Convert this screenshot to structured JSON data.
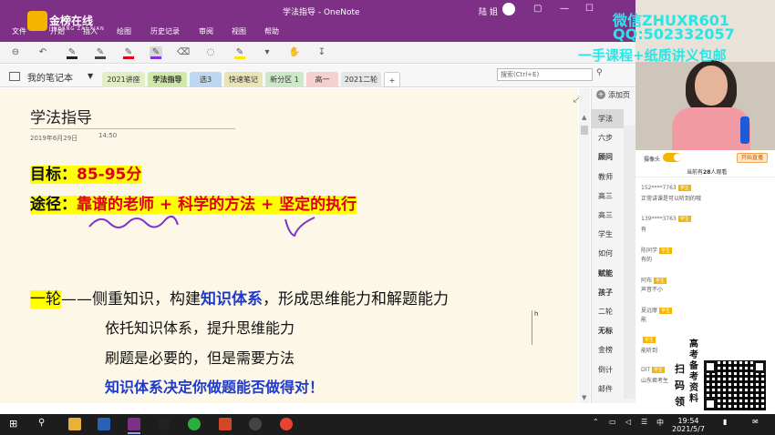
{
  "window": {
    "title": "学法指导 - OneNote",
    "user": "陆 姐",
    "brand": "金榜在线",
    "brand_sub": "JINBANG ZAI XIAN"
  },
  "ribbon_tabs": [
    "文件",
    "开始",
    "插入",
    "绘图",
    "历史记录",
    "审阅",
    "视图",
    "帮助"
  ],
  "notebook": {
    "name": "我的笔记本",
    "sections": [
      {
        "label": "2021讲座",
        "color": "#e3edc6"
      },
      {
        "label": "学法指导",
        "color": "#d8edb9"
      },
      {
        "label": "选3",
        "color": "#bfd8ef"
      },
      {
        "label": "快速笔记",
        "color": "#e9e4b6"
      },
      {
        "label": "新分区 1",
        "color": "#cde8c6"
      },
      {
        "label": "高一",
        "color": "#f4d0d0"
      },
      {
        "label": "2021二轮",
        "color": "#e6e6e6"
      }
    ],
    "add_tab": "+",
    "search_placeholder": "搜索(Ctrl+E)"
  },
  "page": {
    "title": "学法指导",
    "date": "2019年6月29日",
    "time": "14:50",
    "goal_label": "目标：",
    "goal_value": "85-95分",
    "path_label": "途径：",
    "path_value": "靠谱的老师 + 科学的方法 + 坚定的执行",
    "round_label": "一轮",
    "round_dash": "——侧重知识，构建",
    "round_blue": "知识体系",
    "round_rest": "，形成思维能力和解题能力",
    "line2": "依托知识体系，提升思维能力",
    "line3": "刷题是必要的，但是需要方法",
    "line4": "知识体系决定你做题能否做得对！",
    "cursor_mark": "h"
  },
  "page_list": {
    "add_label": "添加页",
    "items": [
      {
        "label": "学法",
        "selected": true,
        "bold": false
      },
      {
        "label": "六步",
        "selected": false,
        "bold": false
      },
      {
        "label": "顾问",
        "selected": false,
        "bold": true
      },
      {
        "label": "教师",
        "selected": false,
        "bold": false
      },
      {
        "label": "高三",
        "selected": false,
        "bold": false
      },
      {
        "label": "高三",
        "selected": false,
        "bold": false
      },
      {
        "label": "学生",
        "selected": false,
        "bold": false
      },
      {
        "label": "如何",
        "selected": false,
        "bold": false
      },
      {
        "label": "赋能",
        "selected": false,
        "bold": true
      },
      {
        "label": "孩子",
        "selected": false,
        "bold": true
      },
      {
        "label": "二轮",
        "selected": false,
        "bold": false
      },
      {
        "label": "无标",
        "selected": false,
        "bold": true
      },
      {
        "label": "金榜",
        "selected": false,
        "bold": false
      },
      {
        "label": "倒计",
        "selected": false,
        "bold": false
      },
      {
        "label": "邮件",
        "selected": false,
        "bold": false
      }
    ]
  },
  "watermark": {
    "line1": "微信ZHUXR601",
    "line2": "QQ:502332057",
    "line3": "一手课程+纸质讲义包邮"
  },
  "live": {
    "cam_label": "摄像头",
    "viewers_prefix": "当前有",
    "viewers_count": "28",
    "viewers_suffix": "人观看",
    "open_button": "开始直播",
    "messages": [
      {
        "name": "152****7763",
        "tag": "学生",
        "text": "正常讲课是可以听到的哦"
      },
      {
        "name": "139****3763",
        "tag": "学生",
        "text": "有"
      },
      {
        "name": "陈同学",
        "tag": "学生",
        "text": "有的"
      },
      {
        "name": "阿布",
        "tag": "学生",
        "text": "声音不小"
      },
      {
        "name": "夏远摩",
        "tag": "学生",
        "text": "能"
      },
      {
        "name": "",
        "tag": "学生",
        "text": "能听到"
      },
      {
        "name": "DIT",
        "tag": "学生",
        "text": "山东君考生 在..."
      }
    ],
    "qr_text": [
      "扫",
      "码",
      "领"
    ],
    "qr_text2": [
      "高",
      "考",
      "备",
      "考",
      "资",
      "料"
    ]
  },
  "taskbar": {
    "ime": "中",
    "time": "19:54",
    "date": "2021/5/7"
  },
  "colors": {
    "titlebar": "#7e2f86",
    "page_bg": "#fdf7e7",
    "highlight": "#ffff00",
    "accent_red": "#e0001a",
    "accent_blue": "#1f3ac8"
  }
}
